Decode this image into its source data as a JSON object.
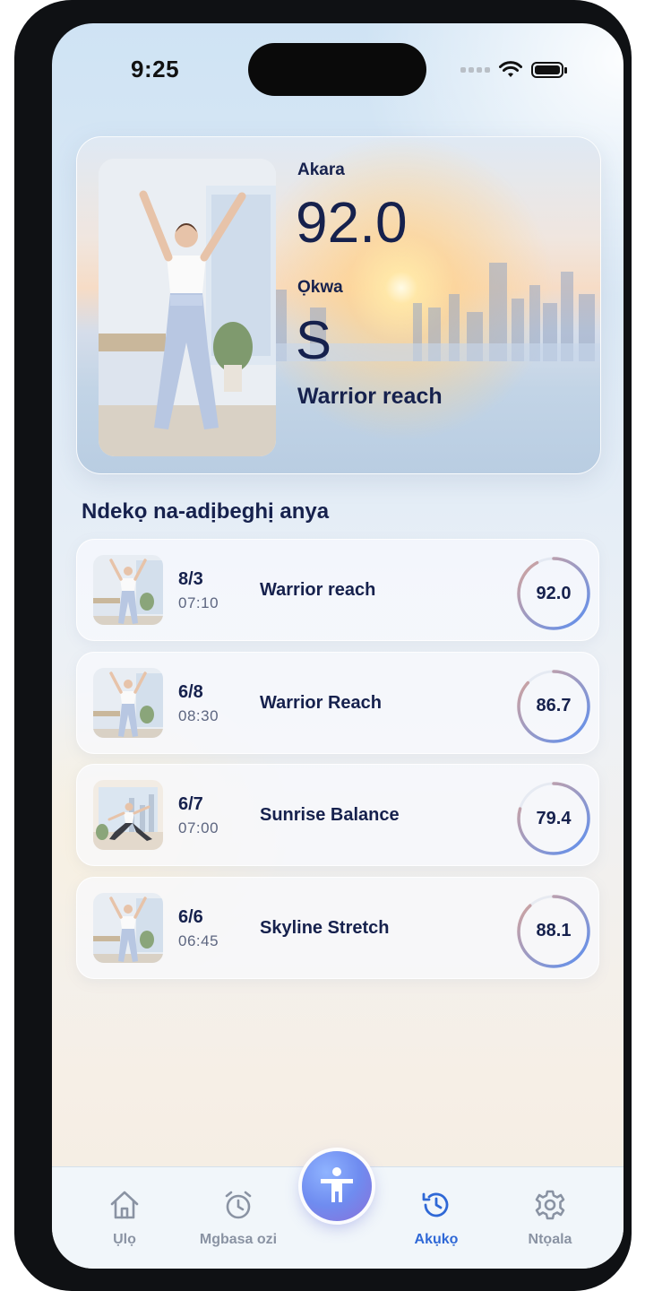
{
  "status_bar": {
    "time": "9:25"
  },
  "hero": {
    "score_label": "Akara",
    "score": "92.0",
    "grade_label": "Ọkwa",
    "grade": "S",
    "exercise_name": "Warrior reach"
  },
  "history": {
    "title": "Ndekọ na-adịbeghị anya",
    "items": [
      {
        "date": "8/3",
        "time": "07:10",
        "name": "Warrior reach",
        "score": "92.0",
        "score_value": 92.0,
        "thumb": "standing-pose"
      },
      {
        "date": "6/8",
        "time": "08:30",
        "name": "Warrior Reach",
        "score": "86.7",
        "score_value": 86.7,
        "thumb": "standing-pose"
      },
      {
        "date": "6/7",
        "time": "07:00",
        "name": "Sunrise Balance",
        "score": "79.4",
        "score_value": 79.4,
        "thumb": "lunge-pose"
      },
      {
        "date": "6/6",
        "time": "06:45",
        "name": "Skyline Stretch",
        "score": "88.1",
        "score_value": 88.1,
        "thumb": "standing-pose"
      }
    ]
  },
  "nav": {
    "items": [
      {
        "label": "Ụlọ",
        "icon": "home-icon",
        "active": false
      },
      {
        "label": "Mgbasa ozi",
        "icon": "alarm-clock-icon",
        "active": false
      },
      {
        "label": "",
        "icon": "person-icon",
        "active": false
      },
      {
        "label": "Akụkọ",
        "icon": "history-icon",
        "active": true
      },
      {
        "label": "Ntọala",
        "icon": "gear-icon",
        "active": false
      }
    ]
  },
  "colors": {
    "primary_text": "#16214d",
    "accent": "#2f68d6",
    "ring_start": "#5b8ef0",
    "ring_end": "#d8a59a"
  }
}
